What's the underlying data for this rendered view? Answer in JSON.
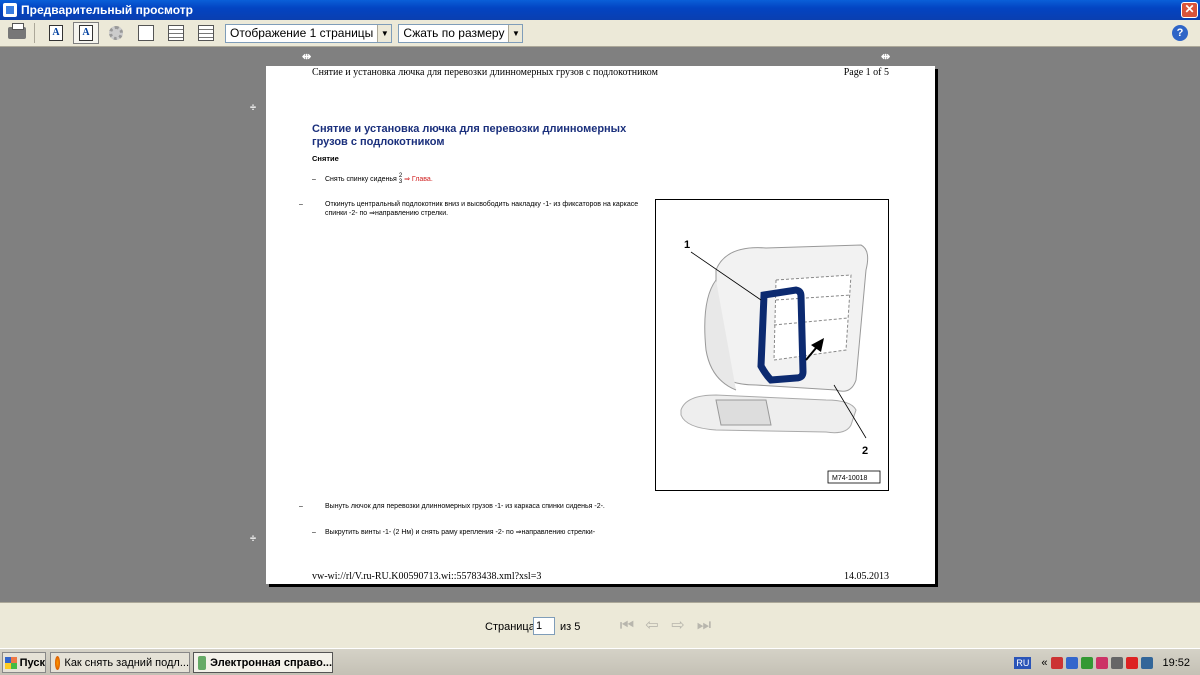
{
  "window": {
    "title": "Предварительный просмотр"
  },
  "toolbar": {
    "buttons": [
      "printer-icon",
      "font-a-icon",
      "font-a-pressed-icon",
      "settings-icon",
      "single-page-icon",
      "page-width-icon",
      "page-fit-icon"
    ],
    "page_view_select": "Отображение 1 страницы",
    "zoom_select": "Сжать по размеру"
  },
  "page": {
    "header_title": "Снятие и установка лючка для перевозки длинномерных грузов с подлокотником",
    "header_page": "Page 1 of 5",
    "doc_title": "Снятие и установка лючка для перевозки длинномерных грузов с подлокотником",
    "subhead": "Снятие",
    "step1_text": "Снять спинку сиденья",
    "step1_frac_top": "2",
    "step1_frac_bottom": "3",
    "step1_link": "⇒ Глава.",
    "step2_text": "Откинуть центральный подлокотник вниз и высвободить накладку -1- из фиксаторов на каркасе спинки -2- по ⇒направлению стрелки.",
    "step3_text": "Вынуть лючок для перевозки длинномерных грузов -1- из каркаса спинки сиденья -2-.",
    "step4_text": "Выкрутить винты -1- (2 Нм) и снять раму крепления -2- по ⇒направлению стрелки-",
    "figure": {
      "label1": "1",
      "label2": "2",
      "code": "M74-10018"
    },
    "footer_url": "vw-wi://rl/V.ru-RU.K00590713.wi::55783438.xml?xsl=3",
    "footer_date": "14.05.2013"
  },
  "nav": {
    "page_label": "Страница",
    "page_value": "1",
    "of_label": "из 5"
  },
  "taskbar": {
    "start": "Пуск",
    "tasks": [
      "Как снять задний подл...",
      "Электронная справо..."
    ],
    "lang": "RU",
    "clock": "19:52",
    "tray_chevron": "«"
  }
}
